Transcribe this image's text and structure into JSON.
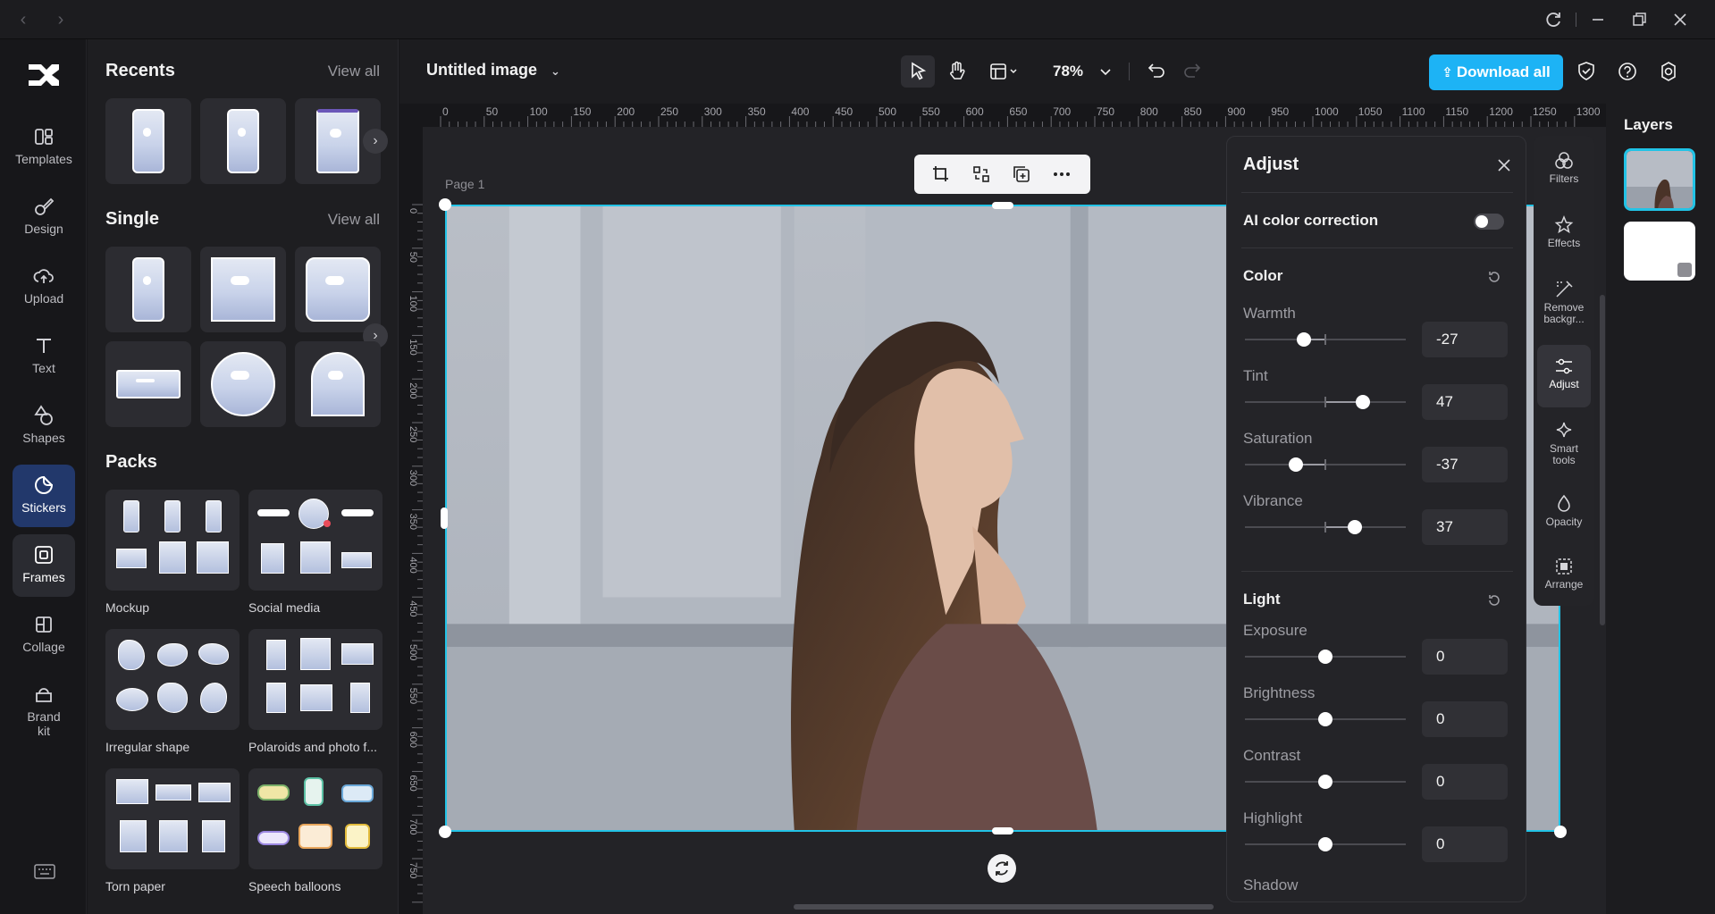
{
  "rail": {
    "items": [
      {
        "label": "Templates",
        "icon": "templates-icon"
      },
      {
        "label": "Design",
        "icon": "design-icon"
      },
      {
        "label": "Upload",
        "icon": "upload-icon"
      },
      {
        "label": "Text",
        "icon": "text-icon"
      },
      {
        "label": "Shapes",
        "icon": "shapes-icon"
      },
      {
        "label": "Stickers",
        "icon": "stickers-icon"
      },
      {
        "label": "Frames",
        "icon": "frames-icon"
      },
      {
        "label": "Collage",
        "icon": "collage-icon"
      },
      {
        "label": "Brand kit",
        "icon": "brand-kit-icon"
      }
    ],
    "active": "Stickers"
  },
  "panel": {
    "recents_title": "Recents",
    "single_title": "Single",
    "packs_title": "Packs",
    "view_all": "View all",
    "packs": [
      "Mockup",
      "Social media",
      "Irregular shape",
      "Polaroids and photo f...",
      "Torn paper",
      "Speech balloons"
    ]
  },
  "topbar": {
    "doc_title": "Untitled image",
    "zoom": "78%",
    "download_label": "Download all"
  },
  "canvas": {
    "page_label": "Page 1",
    "ruler_h": [
      "0",
      "50",
      "100",
      "150",
      "200",
      "250",
      "300",
      "350",
      "400",
      "450",
      "500",
      "550",
      "600",
      "650",
      "700",
      "750",
      "800",
      "850",
      "900",
      "950",
      "1000",
      "1050",
      "1100",
      "1150",
      "1200",
      "1250",
      "1300"
    ],
    "ruler_v": [
      "0",
      "50",
      "100",
      "150",
      "200",
      "250",
      "300",
      "350",
      "400",
      "450",
      "500",
      "550",
      "600",
      "650",
      "700",
      "750"
    ]
  },
  "adjust": {
    "title": "Adjust",
    "ai_label": "AI color correction",
    "ai_enabled": false,
    "color_title": "Color",
    "light_title": "Light",
    "color_sliders": [
      {
        "label": "Warmth",
        "value": "-27",
        "level": -27
      },
      {
        "label": "Tint",
        "value": "47",
        "level": 47
      },
      {
        "label": "Saturation",
        "value": "-37",
        "level": -37
      },
      {
        "label": "Vibrance",
        "value": "37",
        "level": 37
      }
    ],
    "light_sliders": [
      {
        "label": "Exposure",
        "value": "0",
        "level": 0
      },
      {
        "label": "Brightness",
        "value": "0",
        "level": 0
      },
      {
        "label": "Contrast",
        "value": "0",
        "level": 0
      },
      {
        "label": "Highlight",
        "value": "0",
        "level": 0
      }
    ],
    "next_label": "Shadow"
  },
  "tools": [
    {
      "label": "Filters",
      "icon": "filters-icon"
    },
    {
      "label": "Effects",
      "icon": "effects-icon"
    },
    {
      "label": "Remove backgr...",
      "icon": "remove-background-icon"
    },
    {
      "label": "Adjust",
      "icon": "adjust-icon"
    },
    {
      "label": "Smart tools",
      "icon": "smart-tools-icon"
    },
    {
      "label": "Opacity",
      "icon": "opacity-icon"
    },
    {
      "label": "Arrange",
      "icon": "arrange-icon"
    }
  ],
  "layers": {
    "title": "Layers"
  },
  "colors": {
    "accent": "#1db3f5",
    "selection": "#22c3e6",
    "rail_active": "#22386b"
  }
}
